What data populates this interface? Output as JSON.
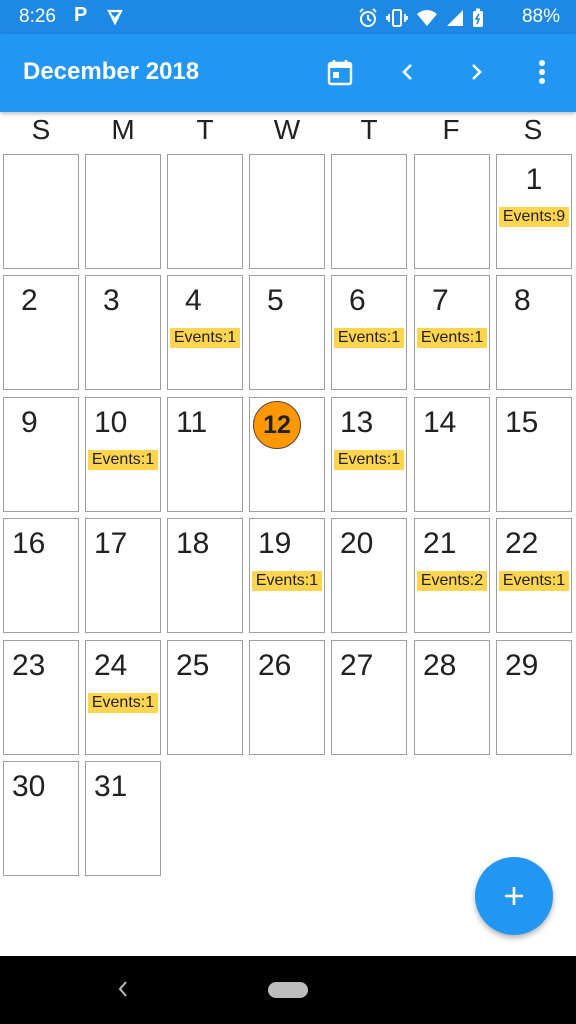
{
  "status_bar": {
    "time": "8:26",
    "app_icon_letter": "P",
    "battery": "88%"
  },
  "app_bar": {
    "title": "December 2018",
    "icons": [
      "calendar-today-icon",
      "chevron-left-icon",
      "chevron-right-icon",
      "more-vert-icon"
    ]
  },
  "week_days": [
    "S",
    "M",
    "T",
    "W",
    "T",
    "F",
    "S"
  ],
  "calendar": {
    "today": "12",
    "days": [
      {
        "day": "",
        "events": ""
      },
      {
        "day": "",
        "events": ""
      },
      {
        "day": "",
        "events": ""
      },
      {
        "day": "",
        "events": ""
      },
      {
        "day": "",
        "events": ""
      },
      {
        "day": "",
        "events": ""
      },
      {
        "day": "1",
        "events": "Events:9"
      },
      {
        "day": "2",
        "events": ""
      },
      {
        "day": "3",
        "events": ""
      },
      {
        "day": "4",
        "events": "Events:1"
      },
      {
        "day": "5",
        "events": ""
      },
      {
        "day": "6",
        "events": "Events:1"
      },
      {
        "day": "7",
        "events": "Events:1"
      },
      {
        "day": "8",
        "events": ""
      },
      {
        "day": "9",
        "events": ""
      },
      {
        "day": "10",
        "events": "Events:1"
      },
      {
        "day": "11",
        "events": ""
      },
      {
        "day": "12",
        "events": ""
      },
      {
        "day": "13",
        "events": "Events:1"
      },
      {
        "day": "14",
        "events": ""
      },
      {
        "day": "15",
        "events": ""
      },
      {
        "day": "16",
        "events": ""
      },
      {
        "day": "17",
        "events": ""
      },
      {
        "day": "18",
        "events": ""
      },
      {
        "day": "19",
        "events": "Events:1"
      },
      {
        "day": "20",
        "events": ""
      },
      {
        "day": "21",
        "events": "Events:2"
      },
      {
        "day": "22",
        "events": "Events:1"
      },
      {
        "day": "23",
        "events": ""
      },
      {
        "day": "24",
        "events": "Events:1"
      },
      {
        "day": "25",
        "events": ""
      },
      {
        "day": "26",
        "events": ""
      },
      {
        "day": "27",
        "events": ""
      },
      {
        "day": "28",
        "events": ""
      },
      {
        "day": "29",
        "events": ""
      },
      {
        "day": "30",
        "events": ""
      },
      {
        "day": "31",
        "events": ""
      }
    ]
  },
  "fab": {
    "icon": "add-icon"
  },
  "colors": {
    "status_bar": "#1e88e5",
    "app_bar": "#2196f3",
    "event_badge": "#ffd54f",
    "today_highlight": "#ff9800",
    "fab": "#2196f3"
  }
}
